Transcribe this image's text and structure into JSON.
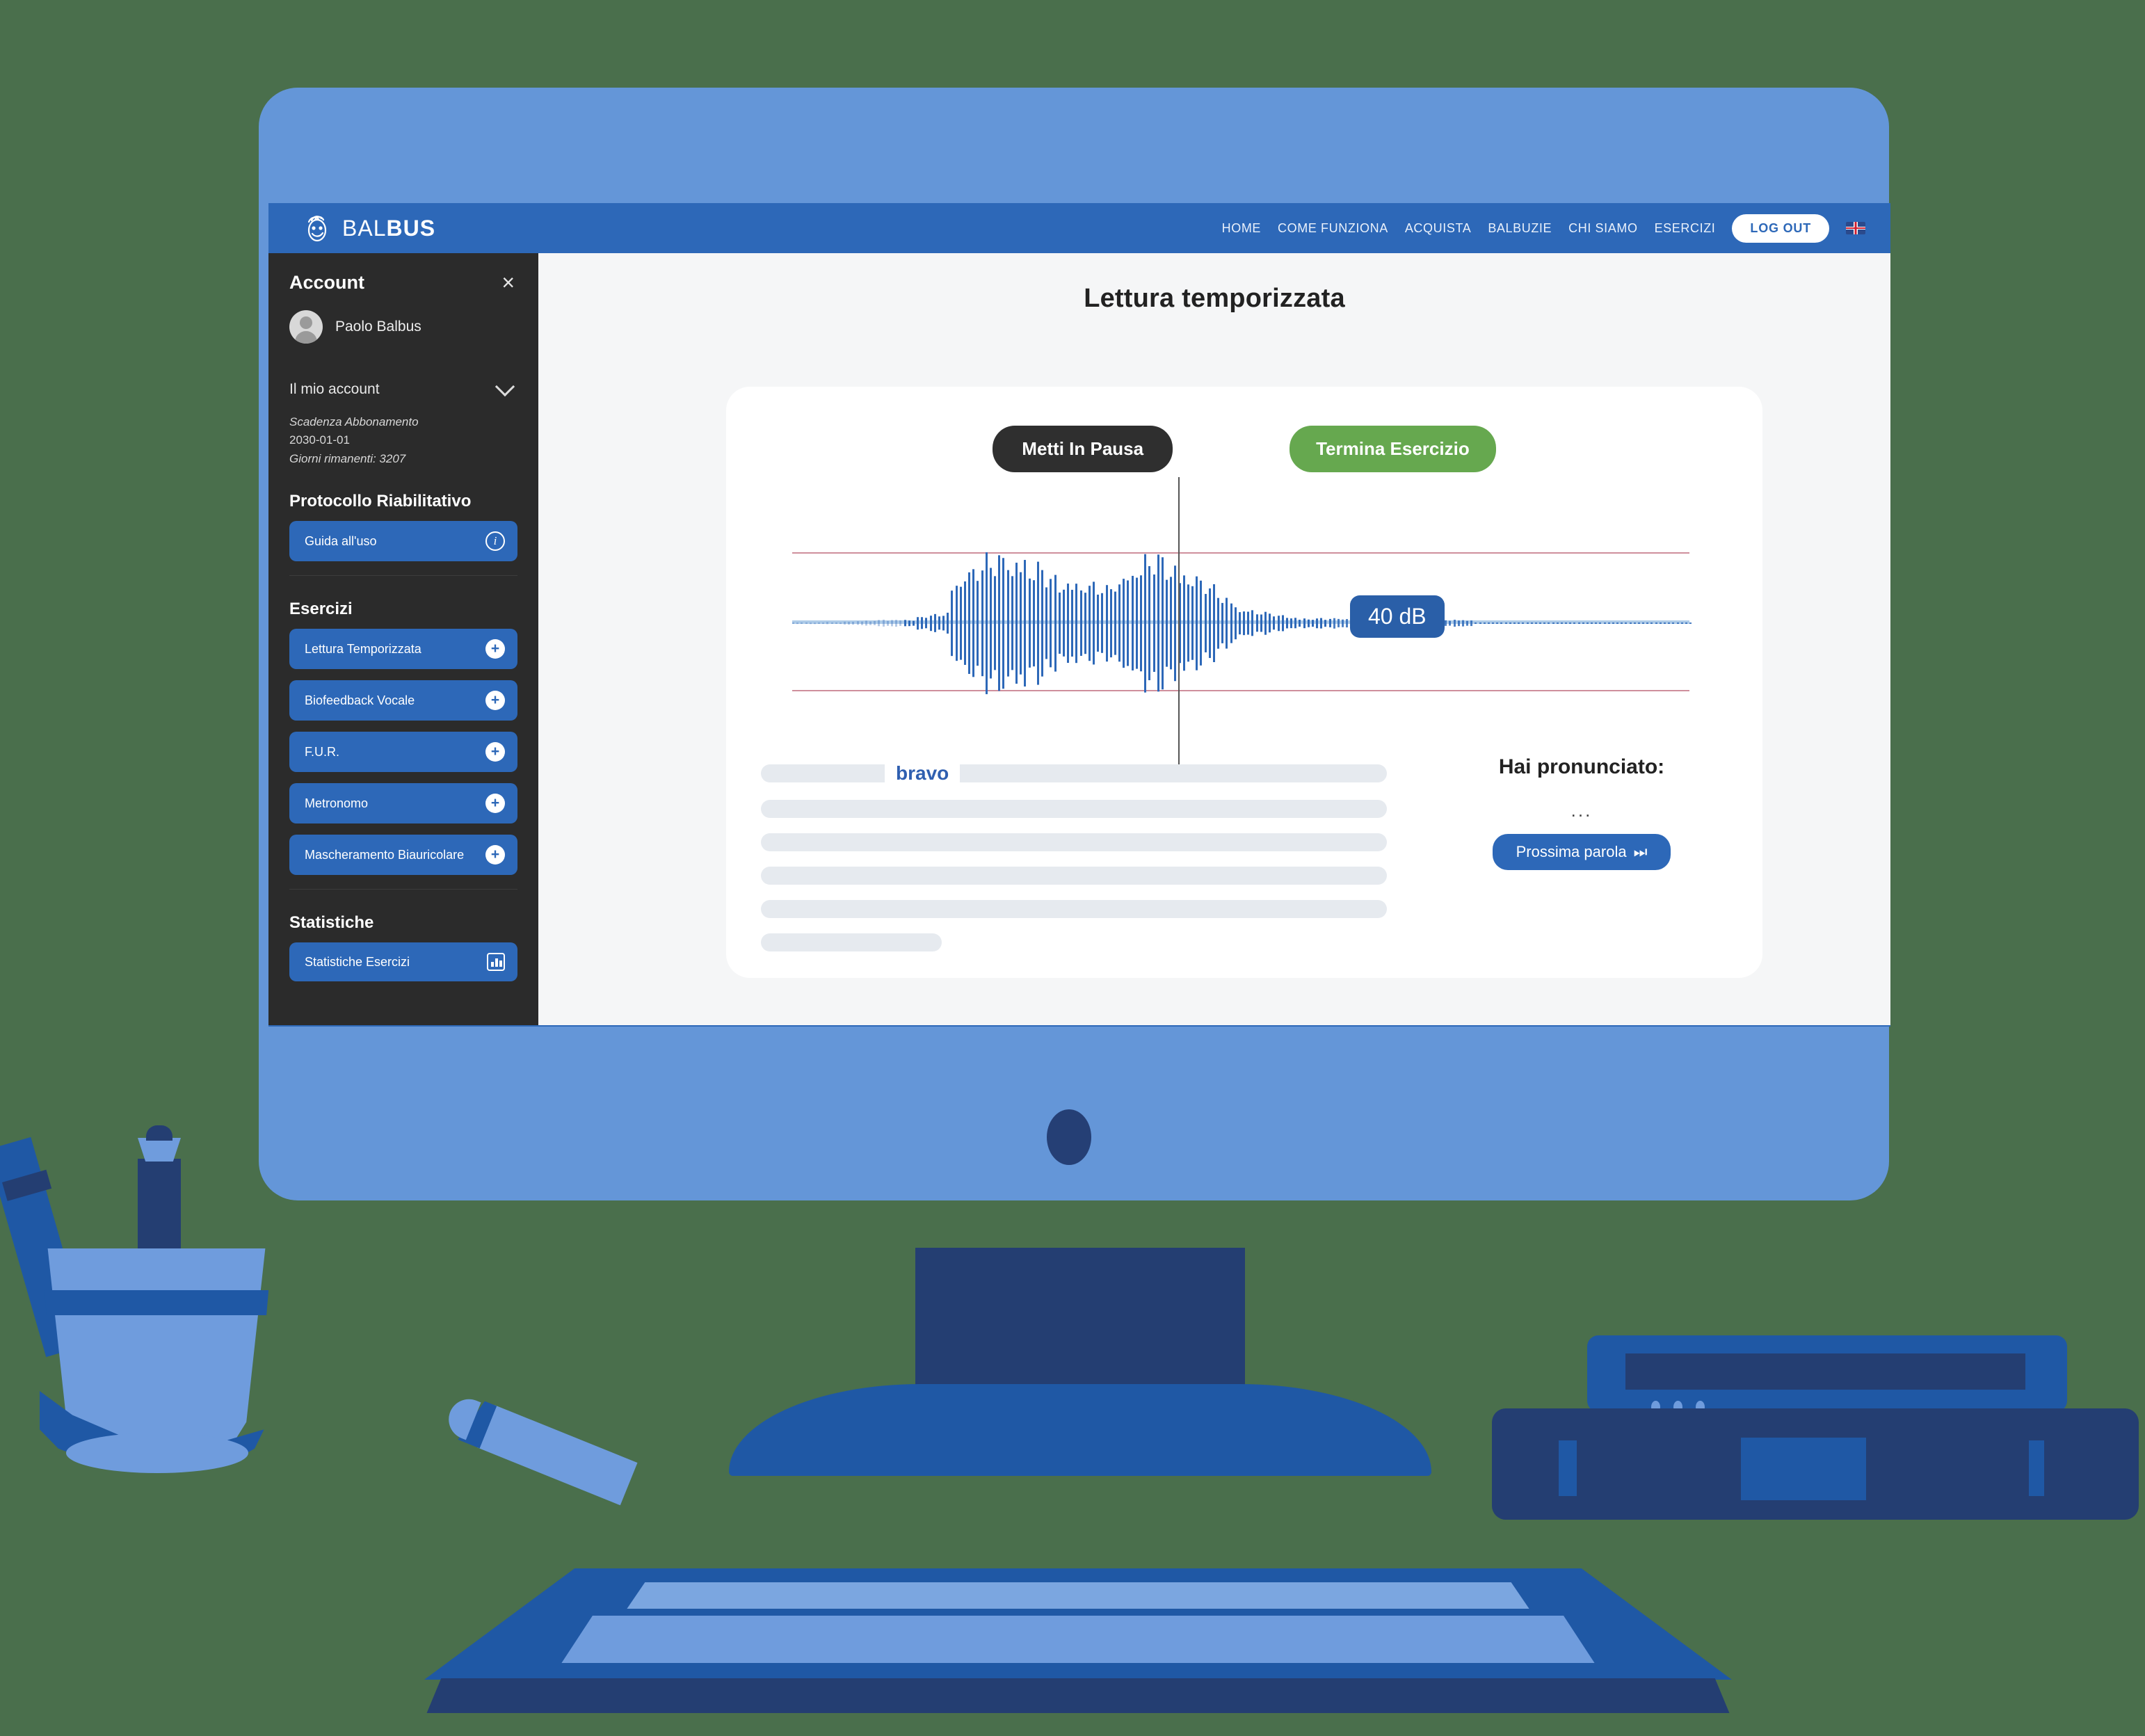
{
  "nav": {
    "brand": "BALBUS",
    "brand_bold_part": "BUS",
    "links": [
      "HOME",
      "COME FUNZIONA",
      "ACQUISTA",
      "BALBUZIE",
      "CHI SIAMO",
      "ESERCIZI"
    ],
    "logout_label": "LOG OUT",
    "flag_name": "uk-flag-icon"
  },
  "sidebar": {
    "title": "Account",
    "close_label": "×",
    "user_name": "Paolo Balbus",
    "account_toggle": "Il mio account",
    "subscription_label": "Scadenza Abbonamento",
    "subscription_date": "2030-01-01",
    "days_remaining": "Giorni rimanenti: 3207",
    "protocol_heading": "Protocollo Riabilitativo",
    "guide_button": "Guida all'uso",
    "exercises_heading": "Esercizi",
    "exercises": [
      "Lettura Temporizzata",
      "Biofeedback Vocale",
      "F.U.R.",
      "Metronomo",
      "Mascheramento Biauricolare"
    ],
    "stats_heading": "Statistiche",
    "stats_button": "Statistiche Esercizi"
  },
  "main": {
    "page_title": "Lettura temporizzata",
    "pause_button": "Metti In Pausa",
    "stop_button": "Termina Esercizio",
    "db_badge": "40 dB",
    "highlighted_word": "bravo",
    "pronounced_title": "Hai pronunciato:",
    "pronounced_value": "...",
    "next_word_button": "Prossima parola",
    "next_word_icon": "⏭"
  },
  "colors": {
    "brand_blue": "#2d68b8",
    "dark_navy": "#243e72",
    "light_blue": "#6496d8",
    "sidebar_dark": "#2b2b2b",
    "green": "#66a84f",
    "desk_green": "#4a6f4c",
    "waveform_blue": "#2d68b8",
    "threshold_red": "#cf8f9c"
  }
}
